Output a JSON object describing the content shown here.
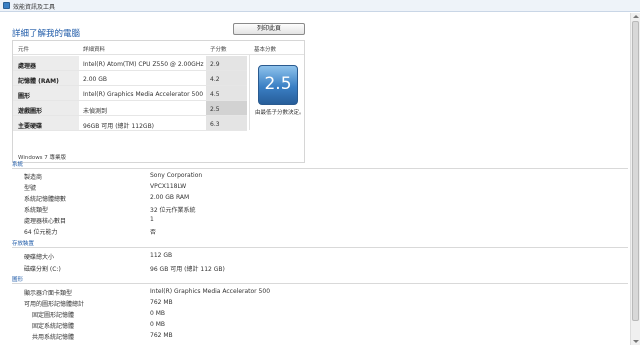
{
  "window": {
    "title": "效能資訊及工具"
  },
  "page": {
    "heading": "詳細了解我的電腦",
    "print_button": "列印此頁",
    "score_table": {
      "headers": {
        "component": "元件",
        "details": "詳細資料",
        "subscore": "子分數",
        "base": "基本分數"
      },
      "rows": [
        {
          "component": "處理器",
          "details": "Intel(R) Atom(TM) CPU Z550 @ 2.00GHz",
          "subscore": "2.9"
        },
        {
          "component": "記憶體 (RAM)",
          "details": "2.00 GB",
          "subscore": "4.2"
        },
        {
          "component": "圖形",
          "details": "Intel(R) Graphics Media Accelerator 500",
          "subscore": "4.5"
        },
        {
          "component": "遊戲圖形",
          "details": "未偵測到",
          "subscore": "2.5"
        },
        {
          "component": "主要硬碟",
          "details": "96GB 可用 (總計 112GB)",
          "subscore": "6.3"
        }
      ],
      "base_score": "2.5",
      "base_note": "由最低子分數決定。",
      "edition": "Windows 7 專業版"
    },
    "system": {
      "title": "系統",
      "items": [
        {
          "label": "製造商",
          "value": "Sony Corporation"
        },
        {
          "label": "型號",
          "value": "VPCX118LW"
        },
        {
          "label": "系統記憶體總數",
          "value": "2.00 GB RAM"
        },
        {
          "label": "系統類型",
          "value": "32 位元作業系統"
        },
        {
          "label": "處理器核心數目",
          "value": "1"
        },
        {
          "label": "64 位元能力",
          "value": "否"
        }
      ]
    },
    "storage": {
      "title": "存放裝置",
      "items": [
        {
          "label": "硬碟總大小",
          "value": "112 GB"
        },
        {
          "label": "磁碟分割 (C:)",
          "value": "96 GB 可用 (總計 112 GB)"
        }
      ]
    },
    "graphics": {
      "title": "圖形",
      "items": [
        {
          "label": "顯示器介面卡類型",
          "value": "Intel(R) Graphics Media Accelerator 500"
        },
        {
          "label": "可用的圖形記憶體總計",
          "value": "762 MB"
        },
        {
          "label": "固定圖形記憶體",
          "value": "0 MB"
        },
        {
          "label": "固定系統記憶體",
          "value": "0 MB"
        },
        {
          "label": "共用系統記憶體",
          "value": "762 MB"
        }
      ]
    }
  },
  "colors": {
    "accent": "#1e5aa8",
    "badge": "#3a7fc4"
  }
}
